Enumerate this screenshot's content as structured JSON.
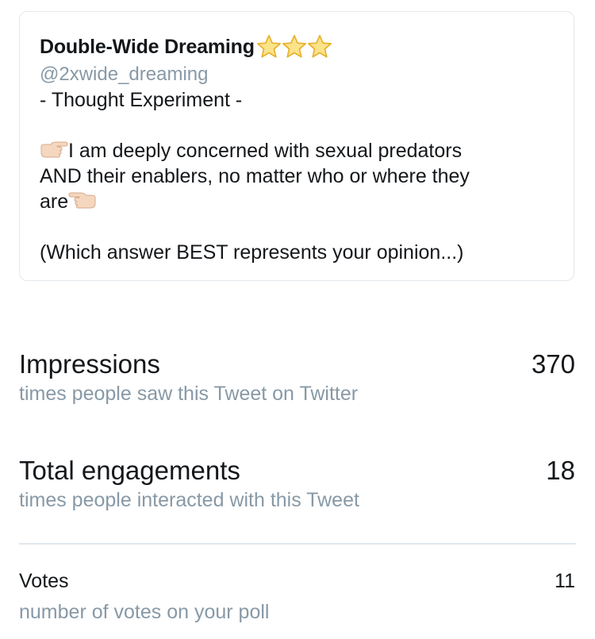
{
  "tweet": {
    "author_name": "Double-Wide Dreaming",
    "author_badge_icons": [
      "star-icon",
      "star-icon",
      "star-icon"
    ],
    "handle": "@2xwide_dreaming",
    "line1": "- Thought Experiment -",
    "body_lead_icon": "pointing-right-icon",
    "body_line1": "I am deeply concerned with sexual predators",
    "body_line2": "AND their enablers, no matter who or where they",
    "body_line3": "are",
    "body_trail_icon": "pointing-left-icon",
    "question": "(Which answer BEST represents your opinion...)"
  },
  "stats": {
    "impressions": {
      "label": "Impressions",
      "value": "370",
      "description": "times people saw this Tweet on Twitter"
    },
    "engagements": {
      "label": "Total engagements",
      "value": "18",
      "description": "times people interacted with this Tweet"
    },
    "votes": {
      "label": "Votes",
      "value": "11",
      "description": "number of votes on your poll"
    }
  },
  "colors": {
    "text_primary": "#14171a",
    "text_secondary": "#8899a6",
    "border": "#e1e8ed",
    "star": "#f7c541",
    "hand": "#f5d7bf"
  }
}
